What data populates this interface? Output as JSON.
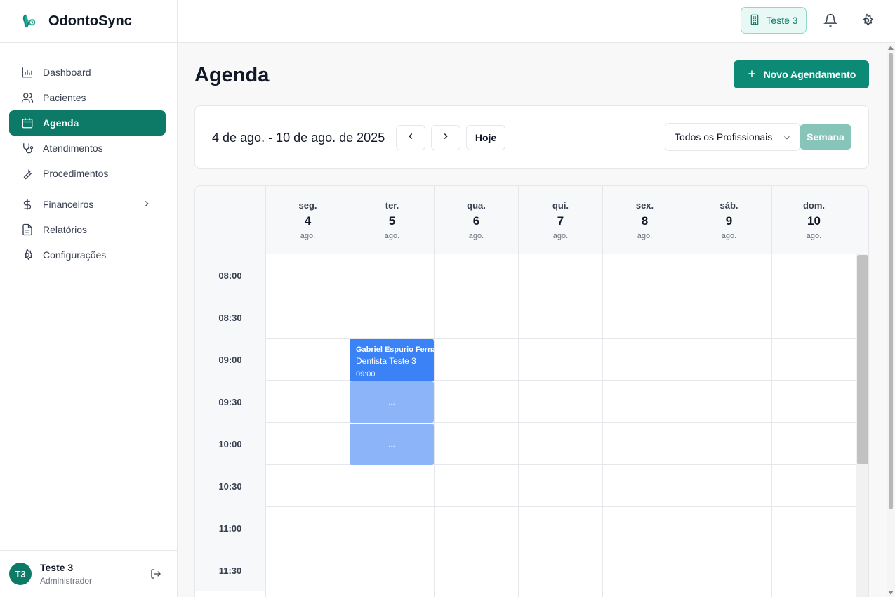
{
  "brand": {
    "name": "OdontoSync",
    "accent": "#0d7a68"
  },
  "sidebar": {
    "items": [
      {
        "label": "Dashboard",
        "icon": "bar-chart-icon"
      },
      {
        "label": "Pacientes",
        "icon": "users-icon"
      },
      {
        "label": "Agenda",
        "icon": "calendar-icon",
        "active": true
      },
      {
        "label": "Atendimentos",
        "icon": "stethoscope-icon"
      },
      {
        "label": "Procedimentos",
        "icon": "wrench-icon"
      },
      {
        "label": "Financeiros",
        "icon": "dollar-icon",
        "has_submenu": true
      },
      {
        "label": "Relatórios",
        "icon": "file-text-icon"
      },
      {
        "label": "Configurações",
        "icon": "gear-icon"
      }
    ]
  },
  "user": {
    "initials": "T3",
    "name": "Teste 3",
    "role": "Administrador"
  },
  "topbar": {
    "clinic": "Teste 3"
  },
  "page": {
    "title": "Agenda",
    "new_button": "Novo Agendamento"
  },
  "filters": {
    "range": "4 de ago. - 10 de ago. de 2025",
    "today": "Hoje",
    "professional": "Todos os Profissionais",
    "view": "Semana"
  },
  "calendar": {
    "days": [
      {
        "name": "seg.",
        "num": "4",
        "month": "ago."
      },
      {
        "name": "ter.",
        "num": "5",
        "month": "ago."
      },
      {
        "name": "qua.",
        "num": "6",
        "month": "ago."
      },
      {
        "name": "qui.",
        "num": "7",
        "month": "ago."
      },
      {
        "name": "sex.",
        "num": "8",
        "month": "ago."
      },
      {
        "name": "sáb.",
        "num": "9",
        "month": "ago."
      },
      {
        "name": "dom.",
        "num": "10",
        "month": "ago."
      }
    ],
    "times": [
      "08:00",
      "08:30",
      "09:00",
      "09:30",
      "10:00",
      "10:30",
      "11:00",
      "11:30"
    ],
    "appointment": {
      "patient": "Gabriel Espurio Fernandes",
      "doctor": "Dentista Teste 3",
      "time": "09:00",
      "continuation": "..."
    }
  }
}
